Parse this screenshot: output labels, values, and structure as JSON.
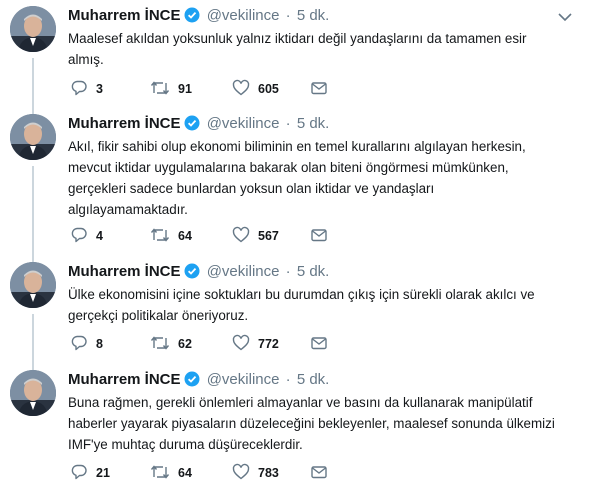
{
  "tweets": [
    {
      "name": "Muharrem İNCE",
      "handle": "@vekilince",
      "dot": "·",
      "time": "5 dk.",
      "text": "Maalesef akıldan yoksunluk yalnız iktidarı değil yandaşlarını da tamamen esir\nalmış.",
      "replies": "3",
      "retweets": "91",
      "likes": "605"
    },
    {
      "name": "Muharrem İNCE",
      "handle": "@vekilince",
      "dot": "·",
      "time": "5 dk.",
      "text": "Akıl, fikir sahibi olup ekonomi biliminin en temel kurallarını algılayan herkesin,\nmevcut iktidar uygulamalarına bakarak olan biteni öngörmesi mümkünken,\ngerçekleri sadece bunlardan yoksun olan iktidar ve yandaşları\nalgılayamamaktadır.",
      "replies": "4",
      "retweets": "64",
      "likes": "567"
    },
    {
      "name": "Muharrem İNCE",
      "handle": "@vekilince",
      "dot": "·",
      "time": "5 dk.",
      "text": "Ülke ekonomisini içine soktukları bu durumdan çıkış için sürekli olarak akılcı ve\ngerçekçi politikalar öneriyoruz.",
      "replies": "8",
      "retweets": "62",
      "likes": "772"
    },
    {
      "name": "Muharrem İNCE",
      "handle": "@vekilince",
      "dot": "·",
      "time": "5 dk.",
      "text": "Buna rağmen, gerekli önlemleri almayanlar ve basını da kullanarak manipülatif\nhaberler yayarak piyasaların düzeleceğini bekleyenler, maalesef sonunda ülkemizi\nIMF'ye muhtaç duruma düşüreceklerdir.",
      "replies": "21",
      "retweets": "64",
      "likes": "783"
    }
  ],
  "icons": {
    "verified": "verified-badge-icon",
    "reply": "reply-icon",
    "retweet": "retweet-icon",
    "like": "heart-icon",
    "dm": "envelope-icon",
    "caret": "chevron-down-icon"
  },
  "colors": {
    "verified": "#1da1f2",
    "text": "#14171a",
    "muted": "#657786",
    "thread_line": "#ccd6dd"
  }
}
